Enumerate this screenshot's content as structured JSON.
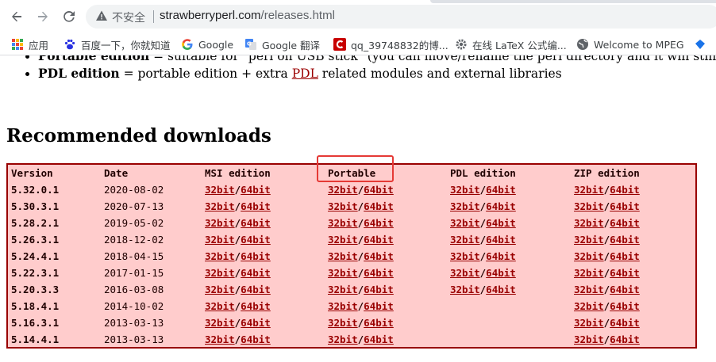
{
  "browser": {
    "back_icon": "arrow-left",
    "forward_icon": "arrow-right",
    "reload_icon": "reload",
    "security_label": "不安全",
    "url_host": "strawberryperl.com",
    "url_path": "/releases.html"
  },
  "bookmarks": [
    {
      "label": "应用",
      "icon": "apps-grid",
      "color": "#ea4335"
    },
    {
      "label": "百度一下，你就知道",
      "icon": "baidu-paw",
      "color": "#2932e1"
    },
    {
      "label": "Google",
      "icon": "google-g",
      "color": "#4285f4"
    },
    {
      "label": "Google 翻译",
      "icon": "translate",
      "color": "#4285f4"
    },
    {
      "label": "qq_39748832的博...",
      "icon": "csdn-c",
      "color": "#c80000"
    },
    {
      "label": "在线 LaTeX 公式编...",
      "icon": "gear",
      "color": "#5f6368"
    },
    {
      "label": "Welcome to MPEG",
      "icon": "globe",
      "color": "#5f6368"
    }
  ],
  "content": {
    "bullet1_bold": "Portable edition",
    "bullet1_rest": " = suitable for \"perl on USB stick\" (you can move/rename the perl directory and it will still work)",
    "bullet2_bold": "PDL edition",
    "bullet2_mid": " = portable edition + extra ",
    "bullet2_link": "PDL",
    "bullet2_rest": " related modules and external libraries",
    "heading": "Recommended downloads"
  },
  "table": {
    "headers": [
      "Version",
      "Date",
      "MSI edition",
      "Portable",
      "PDL edition",
      "ZIP edition"
    ],
    "link32": "32bit",
    "link64": "64bit",
    "separator": "/",
    "rows": [
      {
        "version": "5.32.0.1",
        "date": "2020-08-02",
        "msi": true,
        "portable": true,
        "pdl": true,
        "zip": true
      },
      {
        "version": "5.30.3.1",
        "date": "2020-07-13",
        "msi": true,
        "portable": true,
        "pdl": true,
        "zip": true
      },
      {
        "version": "5.28.2.1",
        "date": "2019-05-02",
        "msi": true,
        "portable": true,
        "pdl": true,
        "zip": true
      },
      {
        "version": "5.26.3.1",
        "date": "2018-12-02",
        "msi": true,
        "portable": true,
        "pdl": true,
        "zip": true
      },
      {
        "version": "5.24.4.1",
        "date": "2018-04-15",
        "msi": true,
        "portable": true,
        "pdl": true,
        "zip": true
      },
      {
        "version": "5.22.3.1",
        "date": "2017-01-15",
        "msi": true,
        "portable": true,
        "pdl": true,
        "zip": true
      },
      {
        "version": "5.20.3.3",
        "date": "2016-03-08",
        "msi": true,
        "portable": true,
        "pdl": true,
        "zip": true
      },
      {
        "version": "5.18.4.1",
        "date": "2014-10-02",
        "msi": true,
        "portable": true,
        "pdl": false,
        "zip": true
      },
      {
        "version": "5.16.3.1",
        "date": "2013-03-13",
        "msi": true,
        "portable": true,
        "pdl": false,
        "zip": true
      },
      {
        "version": "5.14.4.1",
        "date": "2013-03-13",
        "msi": true,
        "portable": true,
        "pdl": false,
        "zip": true
      }
    ]
  },
  "colors": {
    "table_bg": "#ffcccc",
    "table_border": "#990000",
    "link": "#990000",
    "highlight": "#e53935"
  }
}
